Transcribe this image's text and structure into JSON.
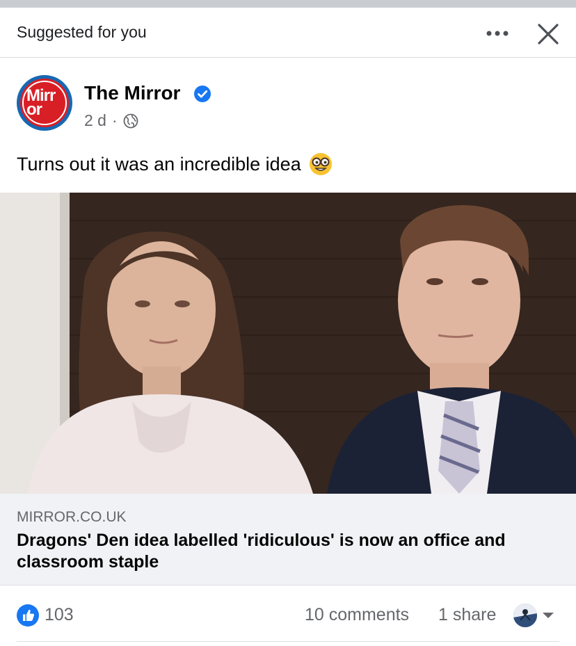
{
  "suggestion": {
    "label": "Suggested for you",
    "more_icon": "more-dots-icon",
    "close_icon": "close-icon"
  },
  "post": {
    "page_name": "The Mirror",
    "avatar_text": "Mirror",
    "verified_icon": "verified-badge-icon",
    "time": "2 d",
    "separator": "·",
    "privacy_icon": "globe-icon",
    "text": "Turns out it was an incredible idea",
    "emoji": "nerd-face-emoji",
    "image_alt": "Photo of a woman and a man seated side by side"
  },
  "link_preview": {
    "domain": "MIRROR.CO.UK",
    "headline": "Dragons' Den idea labelled 'ridiculous' is now an office and classroom staple"
  },
  "engagement": {
    "reaction_icon": "like-icon",
    "reaction_count": "103",
    "comments": "10 comments",
    "shares": "1 share",
    "viewer_icon": "viewer-avatar-icon",
    "caret_icon": "chevron-down-icon"
  },
  "colors": {
    "accent_blue": "#1877f2",
    "brand_red": "#d91f26",
    "secondary_text": "#65676b",
    "link_box_bg": "#f0f2f5"
  }
}
